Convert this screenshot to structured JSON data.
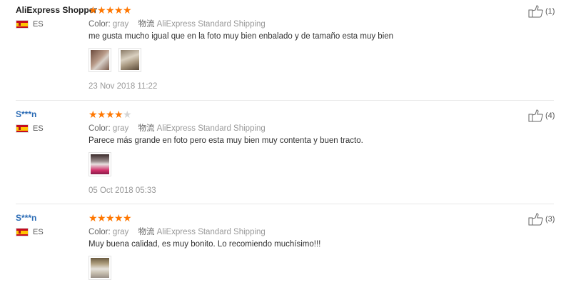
{
  "reviews": [
    {
      "name": "AliExpress Shopper",
      "name_style": "plain",
      "country": "ES",
      "stars": 5,
      "color_label": "Color:",
      "color_value": "gray",
      "shipping_label": "物流",
      "shipping_value": "AliExpress Standard Shipping",
      "text": "me gusta mucho igual que en la foto muy bien enbalado y de tamaño esta muy bien",
      "images": [
        "photo-1",
        "photo-2"
      ],
      "date": "23 Nov 2018 11:22",
      "helpful": "(1)"
    },
    {
      "name": "S***n",
      "name_style": "link",
      "country": "ES",
      "stars": 4,
      "color_label": "Color:",
      "color_value": "gray",
      "shipping_label": "物流",
      "shipping_value": "AliExpress Standard Shipping",
      "text": "Parece más grande en foto pero esta muy bien muy contenta y buen tracto.",
      "images": [
        "photo-1"
      ],
      "date": "05 Oct 2018 05:33",
      "helpful": "(4)"
    },
    {
      "name": "S***n",
      "name_style": "link",
      "country": "ES",
      "stars": 5,
      "color_label": "Color:",
      "color_value": "gray",
      "shipping_label": "物流",
      "shipping_value": "AliExpress Standard Shipping",
      "text": "Muy buena calidad, es muy bonito. Lo recomiendo muchísimo!!!",
      "images": [
        "photo-1"
      ],
      "date": "",
      "helpful": "(3)"
    }
  ],
  "colors": {
    "star_on": "#ff7700",
    "star_off": "#d4d4d4",
    "link": "#2a6bb5"
  },
  "icons": {
    "helpful": "thumbs-up-icon",
    "flag": "spain-flag-icon"
  }
}
